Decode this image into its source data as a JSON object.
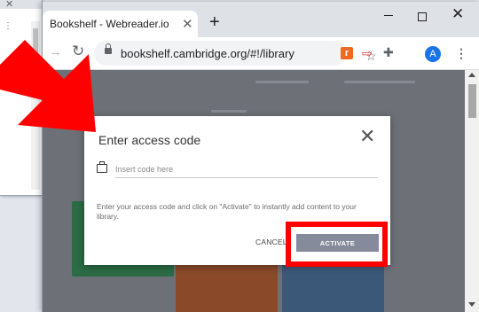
{
  "browser": {
    "tab_title": "Bookshelf - Webreader.io",
    "tab_close": "✕",
    "new_tab": "+",
    "url": "bookshelf.cambridge.org/#!/library",
    "avatar_letter": "A",
    "window_close": "✕"
  },
  "dialog": {
    "title": "Enter access code",
    "close_label": "✕",
    "input_placeholder": "Insert code here",
    "description": "Enter your access code and click on \"Activate\" to instantly add content to your library.",
    "cancel_label": "CANCEL",
    "activate_label": "ACTIVATE"
  },
  "annotations": {
    "arrow_color": "#ff0000",
    "highlight_color": "#ff0000"
  }
}
